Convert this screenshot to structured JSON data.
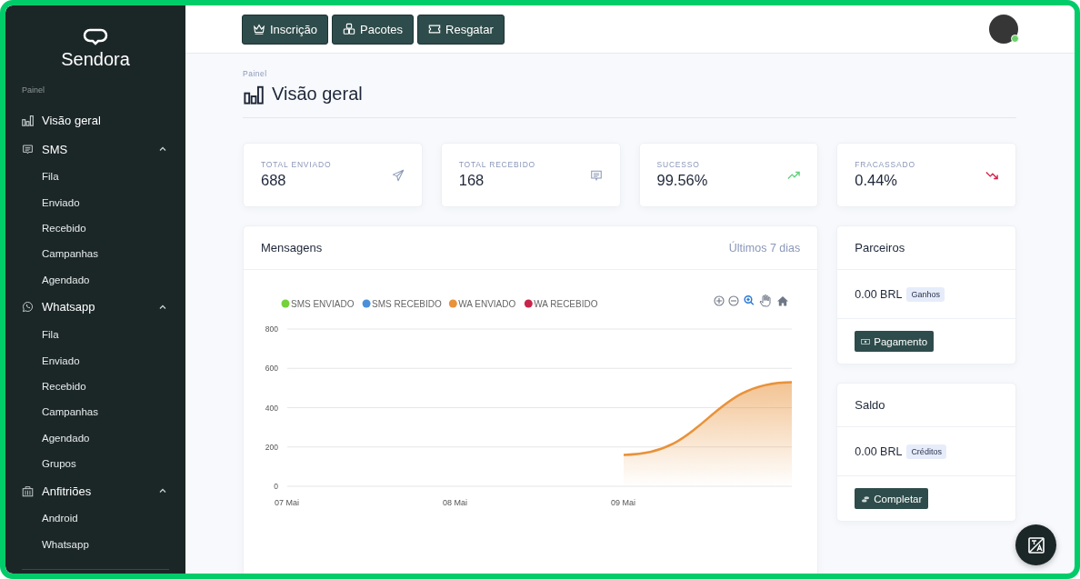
{
  "sidebar": {
    "logo": "Sendora",
    "section": "Painel",
    "items": [
      {
        "label": "Visão geral",
        "kind": "chart"
      },
      {
        "label": "SMS",
        "kind": "message",
        "expanded": true,
        "children": [
          {
            "label": "Fila"
          },
          {
            "label": "Enviado"
          },
          {
            "label": "Recebido"
          },
          {
            "label": "Campanhas"
          },
          {
            "label": "Agendado"
          }
        ]
      },
      {
        "label": "Whatsapp",
        "kind": "whatsapp",
        "expanded": true,
        "children": [
          {
            "label": "Fila"
          },
          {
            "label": "Enviado"
          },
          {
            "label": "Recebido"
          },
          {
            "label": "Campanhas"
          },
          {
            "label": "Agendado"
          },
          {
            "label": "Grupos"
          }
        ]
      },
      {
        "label": "Anfitriões",
        "kind": "hosts",
        "expanded": true,
        "children": [
          {
            "label": "Android"
          },
          {
            "label": "Whatsapp"
          }
        ]
      }
    ]
  },
  "topbar": {
    "buttons": [
      {
        "label": "Inscrição",
        "kind": "crown"
      },
      {
        "label": "Pacotes",
        "kind": "boxes"
      },
      {
        "label": "Resgatar",
        "kind": "ticket"
      }
    ],
    "avatar": {
      "online": true
    }
  },
  "page": {
    "breadcrumb": "Painel",
    "title": "Visão geral"
  },
  "stats": [
    {
      "label": "TOTAL ENVIADO",
      "value": "688",
      "kind": "send"
    },
    {
      "label": "TOTAL RECEBIDO",
      "value": "168",
      "kind": "message"
    },
    {
      "label": "SUCESSO",
      "value": "99.56%",
      "kind": "trend-up"
    },
    {
      "label": "FRACASSADO",
      "value": "0.44%",
      "kind": "trend-down"
    }
  ],
  "messages": {
    "title": "Mensagens",
    "period": "Últimos 7 dias",
    "chart_data": {
      "type": "area",
      "categories": [
        "07 Mai",
        "08 Mai",
        "09 Mai",
        null
      ],
      "ylim": [
        0,
        800
      ],
      "grid": true,
      "yticks": [
        0,
        200,
        400,
        600,
        800
      ],
      "series": [
        {
          "name": "SMS ENVIADO",
          "color": "#74d13b",
          "values": [
            null,
            null,
            null,
            null
          ]
        },
        {
          "name": "SMS RECEBIDO",
          "color": "#4a90d9",
          "values": [
            null,
            null,
            null,
            null
          ]
        },
        {
          "name": "WA ENVIADO",
          "color": "#e8923a",
          "values": [
            null,
            null,
            160,
            530
          ]
        },
        {
          "name": "WA RECEBIDO",
          "color": "#c8254a",
          "values": [
            null,
            null,
            null,
            null
          ]
        }
      ]
    }
  },
  "side_cards": [
    {
      "title": "Parceiros",
      "amount": "0.00 BRL",
      "badge": "Ganhos",
      "button": {
        "label": "Pagamento",
        "kind": "cash"
      }
    },
    {
      "title": "Saldo",
      "amount": "0.00 BRL",
      "badge": "Créditos",
      "button": {
        "label": "Completar",
        "kind": "coins"
      }
    }
  ]
}
